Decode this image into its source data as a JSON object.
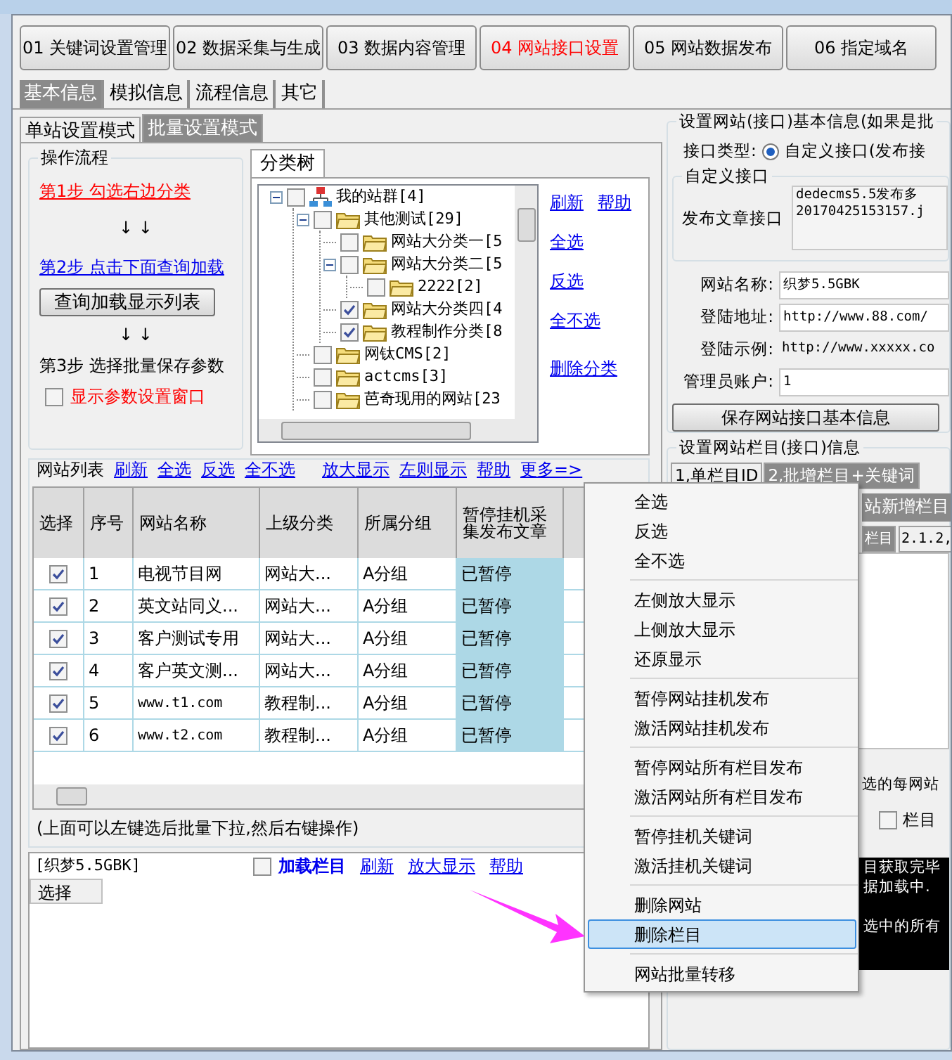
{
  "main_tabs": [
    {
      "label": "01 关键词设置管理",
      "selected": false
    },
    {
      "label": "02 数据采集与生成",
      "selected": false
    },
    {
      "label": "03 数据内容管理",
      "selected": false
    },
    {
      "label": "04 网站接口设置",
      "selected": true
    },
    {
      "label": "05 网站数据发布",
      "selected": false
    },
    {
      "label": "06 指定域名",
      "selected": false
    }
  ],
  "sub_tabs": [
    {
      "label": "基本信息",
      "selected": true
    },
    {
      "label": "模拟信息",
      "selected": false
    },
    {
      "label": "流程信息",
      "selected": false
    },
    {
      "label": "其它",
      "selected": false
    }
  ],
  "mode_tabs": [
    {
      "label": "单站设置模式",
      "selected": false
    },
    {
      "label": "批量设置模式",
      "selected": true
    }
  ],
  "workflow": {
    "title": "操作流程",
    "step1": "第1步  勾选右边分类",
    "arrows": [
      "↓  ↓",
      "↓  ↓"
    ],
    "step2": "第2步  点击下面查询加载",
    "load_button": "查询加载显示列表",
    "step3": "第3步  选择批量保存参数",
    "show_params": {
      "label": "显示参数设置窗口",
      "checked": false
    }
  },
  "category_tree": {
    "title": "分类树",
    "nodes": [
      {
        "label": "我的站群[4]",
        "kind": "network",
        "checked": false,
        "expanded": true,
        "children": [
          {
            "label": "其他测试[29]",
            "kind": "folder",
            "checked": false,
            "expanded": true,
            "children": [
              {
                "label": "网站大分类一[5",
                "kind": "folder",
                "checked": false
              },
              {
                "label": "网站大分类二[5",
                "kind": "folder",
                "checked": false,
                "expanded": true,
                "children": [
                  {
                    "label": "2222[2]",
                    "kind": "folder",
                    "checked": false
                  }
                ]
              },
              {
                "label": "网站大分类四[4",
                "kind": "folder",
                "checked": true
              },
              {
                "label": "教程制作分类[8",
                "kind": "folder",
                "checked": true
              }
            ]
          },
          {
            "label": "网钛CMS[2]",
            "kind": "folder",
            "checked": false
          },
          {
            "label": "actcms[3]",
            "kind": "folder",
            "checked": false
          },
          {
            "label": "芭奇现用的网站[23",
            "kind": "folder",
            "checked": false
          }
        ]
      }
    ],
    "links": [
      [
        "刷新",
        "帮助"
      ],
      [
        "全选"
      ],
      [
        "反选"
      ],
      [
        "全不选"
      ],
      [
        "删除分类"
      ]
    ]
  },
  "site_list": {
    "title": "网站列表",
    "links": [
      "刷新",
      "全选",
      "反选",
      "全不选",
      "放大显示",
      "左则显示",
      "帮助",
      "更多=>"
    ],
    "columns": [
      "选择",
      "序号",
      "网站名称",
      "上级分类",
      "所属分组",
      "暂停挂机采集发布文章"
    ],
    "rows": [
      {
        "checked": true,
        "cells": [
          "",
          "1",
          "电视节目网",
          "网站大...",
          "A分组",
          "已暂停"
        ]
      },
      {
        "checked": true,
        "cells": [
          "",
          "2",
          "英文站同义...",
          "网站大...",
          "A分组",
          "已暂停"
        ]
      },
      {
        "checked": true,
        "cells": [
          "",
          "3",
          "客户测试专用",
          "网站大...",
          "A分组",
          "已暂停"
        ]
      },
      {
        "checked": true,
        "cells": [
          "",
          "4",
          "客户英文测...",
          "网站大...",
          "A分组",
          "已暂停"
        ]
      },
      {
        "checked": true,
        "cells": [
          "",
          "5",
          "www.t1.com",
          "教程制...",
          "A分组",
          "已暂停"
        ]
      },
      {
        "checked": true,
        "cells": [
          "",
          "6",
          "www.t2.com",
          "教程制...",
          "A分组",
          "已暂停"
        ]
      }
    ],
    "note": "(上面可以左键选后批量下拉,然后右键操作)"
  },
  "columns_panel": {
    "site": "[织梦5.5GBK]",
    "load": {
      "label": "加载栏目",
      "checked": false
    },
    "links": [
      "刷新",
      "放大显示",
      "帮助"
    ],
    "header": "选择"
  },
  "basic_info": {
    "title": "设置网站(接口)基本信息(如果是批",
    "type_label": "接口类型:",
    "type_radio": {
      "label": "自定义接口(发布接",
      "selected": true
    },
    "custom": {
      "title": "自定义接口",
      "label": "发布文章接口",
      "value": [
        "dedecms5.5发布多",
        "20170425153157.j"
      ]
    },
    "fields": [
      {
        "kind": "input",
        "label": "网站名称:",
        "value": "织梦5.5GBK"
      },
      {
        "kind": "input",
        "label": "登陆地址:",
        "value": "http://www.88.com/"
      },
      {
        "kind": "text",
        "label": "登陆示例:",
        "value": "http://www.xxxxx.co"
      },
      {
        "kind": "input",
        "label": "管理员账户:",
        "value": "1"
      }
    ],
    "save_button": "保存网站接口基本信息"
  },
  "column_info": {
    "title": "设置网站栏目(接口)信息",
    "tabs": [
      {
        "label": "1,单栏目ID",
        "selected": false
      },
      {
        "label": "2,批增栏目+关键词",
        "selected": true
      }
    ],
    "sub_tab": "站新增栏目",
    "tabs2": [
      {
        "label": "栏目",
        "selected": true
      },
      {
        "label": "2.1.2,",
        "selected": false
      }
    ],
    "hint": "选的每网站",
    "column_check": {
      "label": "栏目",
      "checked": false
    },
    "console": [
      "目获取完毕",
      "据加载中.",
      "选中的所有"
    ]
  },
  "context_menu": [
    [
      {
        "label": "全选",
        "selected": false
      },
      {
        "label": "反选",
        "selected": false
      },
      {
        "label": "全不选",
        "selected": false
      }
    ],
    [
      {
        "label": "左侧放大显示",
        "selected": false
      },
      {
        "label": "上侧放大显示",
        "selected": false
      },
      {
        "label": "还原显示",
        "selected": false
      }
    ],
    [
      {
        "label": "暂停网站挂机发布",
        "selected": false
      },
      {
        "label": "激活网站挂机发布",
        "selected": false
      }
    ],
    [
      {
        "label": "暂停网站所有栏目发布",
        "selected": false
      },
      {
        "label": "激活网站所有栏目发布",
        "selected": false
      }
    ],
    [
      {
        "label": "暂停挂机关键词",
        "selected": false
      },
      {
        "label": "激活挂机关键词",
        "selected": false
      }
    ],
    [
      {
        "label": "删除网站",
        "selected": false
      },
      {
        "label": "删除栏目",
        "selected": true
      }
    ],
    [
      {
        "label": "网站批量转移",
        "selected": false
      }
    ]
  ]
}
